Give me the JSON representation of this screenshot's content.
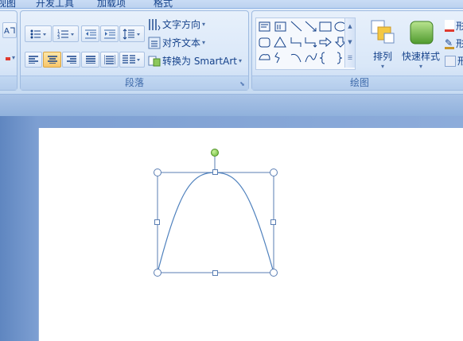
{
  "tabs": [
    "视图",
    "开发工具",
    "加载项",
    "格式"
  ],
  "paragraph_group": {
    "label": "段落",
    "text_direction": "文字方向",
    "align_text": "对齐文本",
    "convert_smartart": "转换为 SmartArt"
  },
  "drawing_group": {
    "label": "绘图",
    "arrange": "排列",
    "quick_styles": "快速样式"
  },
  "right_clipped": [
    "形",
    "形",
    "形"
  ],
  "colors": {
    "ribbon": "#dbe7f7",
    "accent_text": "#15428b",
    "active_button": "#f8c66a",
    "rotate_handle": "#7cc34a",
    "curve": "#4f81bd"
  },
  "icons": [
    "font-size-icon",
    "bullets-icon",
    "numbering-icon",
    "decrease-indent-icon",
    "increase-indent-icon",
    "line-spacing-icon",
    "align-left-icon",
    "align-center-icon",
    "align-right-icon",
    "justify-icon",
    "distribute-icon",
    "columns-icon",
    "text-direction-icon",
    "align-text-icon",
    "smartart-icon",
    "arrange-icon",
    "quick-styles-icon"
  ]
}
